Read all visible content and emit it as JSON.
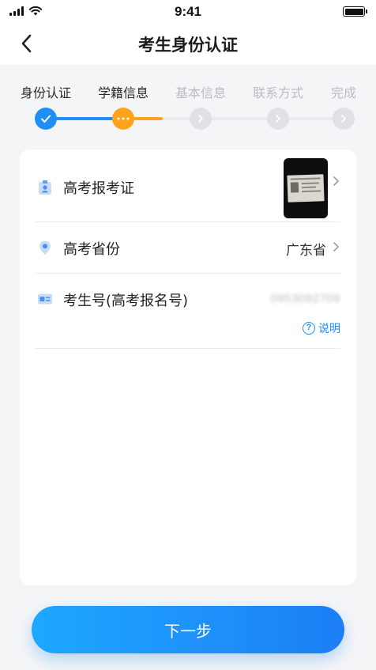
{
  "status_bar": {
    "time": "9:41"
  },
  "nav": {
    "title": "考生身份认证"
  },
  "steps": [
    {
      "label": "身份认证",
      "state": "done"
    },
    {
      "label": "学籍信息",
      "state": "active"
    },
    {
      "label": "基本信息",
      "state": "pending"
    },
    {
      "label": "联系方式",
      "state": "pending"
    },
    {
      "label": "完成",
      "state": "pending"
    }
  ],
  "form": {
    "exam_ticket": {
      "label": "高考报考证",
      "icon": "id-badge-icon"
    },
    "province": {
      "label": "高考省份",
      "value": "广东省",
      "icon": "location-pin-icon"
    },
    "candidate_number": {
      "label": "考生号(高考报名号)",
      "value": "0953092709",
      "icon": "id-card-icon",
      "help_label": "说明"
    }
  },
  "actions": {
    "next_label": "下一步"
  },
  "colors": {
    "accent_blue": "#1f8ef6",
    "active_orange": "#ffa31a",
    "pending_gray": "#dfe1e6",
    "background": "#f4f5f7"
  }
}
